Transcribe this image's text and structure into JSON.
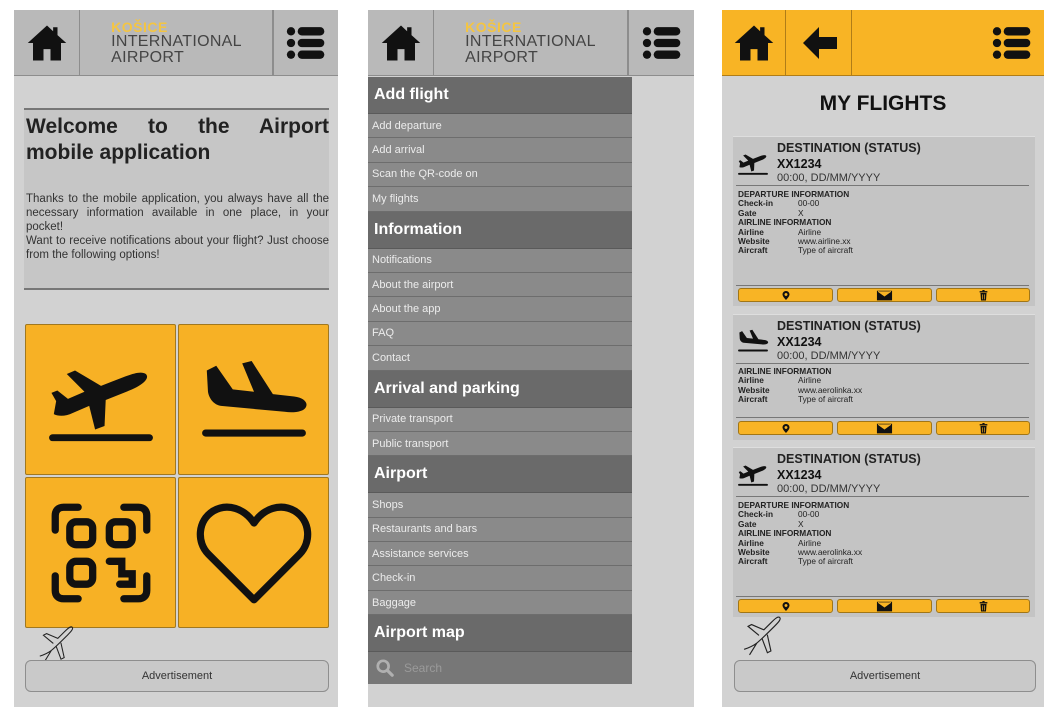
{
  "logo": {
    "line1": "KOŠICE",
    "line2": "INTERNATIONAL",
    "line3": "AIRPORT"
  },
  "screen1": {
    "welcome_title": "Welcome to the Airport mobile application",
    "welcome_body_1": "Thanks to the mobile application, you always have all the necessary information available in one place, in your pocket!",
    "welcome_body_2": "Want to receive notifications about your flight? Just choose from the following options!",
    "tiles": [
      "departure-icon",
      "arrival-icon",
      "qr-code-icon",
      "heart-icon"
    ],
    "ad": "Advertisement"
  },
  "menu": {
    "sections": [
      {
        "title": "Add flight",
        "items": [
          "Add departure",
          "Add arrival",
          "Scan the QR-code on",
          "My flights"
        ]
      },
      {
        "title": "Information",
        "items": [
          "Notifications",
          "About the airport",
          "About the app",
          "FAQ",
          "Contact"
        ]
      },
      {
        "title": "Arrival and parking",
        "items": [
          "Private transport",
          "Public transport"
        ]
      },
      {
        "title": "Airport",
        "items": [
          "Shops",
          "Restaurants and bars",
          "Assistance services",
          "Check-in",
          "Baggage"
        ]
      },
      {
        "title": "Airport map",
        "items": []
      }
    ],
    "search_placeholder": "Search"
  },
  "screen3": {
    "title": "MY FLIGHTS",
    "cards": [
      {
        "kind": "departure",
        "dest": "DESTINATION (STATUS)",
        "code": "XX1234",
        "time": "00:00, DD/MM/YYYY",
        "dep_header": "DEPARTURE INFORMATION",
        "checkin_label": "Check-in",
        "checkin": "00-00",
        "gate_label": "Gate",
        "gate": "X",
        "airline_header": "AIRLINE INFORMATION",
        "airline_label": "Airline",
        "airline": "Airline",
        "website_label": "Website",
        "website": "www.airline.xx",
        "aircraft_label": "Aircraft",
        "aircraft": "Type of aircraft"
      },
      {
        "kind": "arrival",
        "dest": "DESTINATION (STATUS)",
        "code": "XX1234",
        "time": "00:00, DD/MM/YYYY",
        "airline_header": "AIRLINE INFORMATION",
        "airline_label": "Airline",
        "airline": "Airline",
        "website_label": "Website",
        "website": "www.aerolinka.xx",
        "aircraft_label": "Aircraft",
        "aircraft": "Type of aircraft"
      },
      {
        "kind": "departure",
        "dest": "DESTINATION (STATUS)",
        "code": "XX1234",
        "time": "00:00, DD/MM/YYYY",
        "dep_header": "DEPARTURE INFORMATION",
        "checkin_label": "Check-in",
        "checkin": "00-00",
        "gate_label": "Gate",
        "gate": "X",
        "airline_header": "AIRLINE INFORMATION",
        "airline_label": "Airline",
        "airline": "Airline",
        "website_label": "Website",
        "website": "www.aerolinka.xx",
        "aircraft_label": "Aircraft",
        "aircraft": "Type of aircraft"
      }
    ],
    "ad": "Advertisement"
  },
  "colors": {
    "accent": "#f8b425",
    "header_gray": "#b9b9b9",
    "screen_bg": "#d2d2d2",
    "menu_gray": "#6f6f6f"
  }
}
